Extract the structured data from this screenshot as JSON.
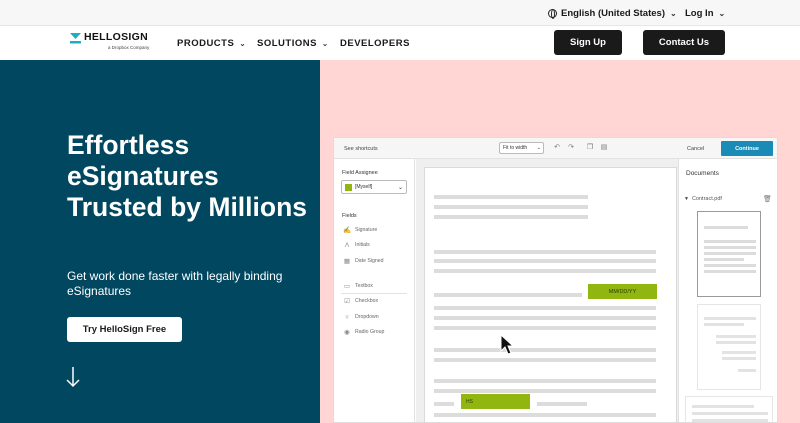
{
  "utility_bar": {
    "language_label": "English (United States)",
    "login_label": "Log In",
    "chevron": "⌄"
  },
  "nav": {
    "logo_text": "HELLOSIGN",
    "logo_subtext": "a Dropbox Company",
    "links": [
      "PRODUCTS",
      "SOLUTIONS",
      "DEVELOPERS"
    ],
    "signup_label": "Sign Up",
    "contact_label": "Contact Us"
  },
  "hero": {
    "title": "Effortless eSignatures Trusted by Millions",
    "subtitle": "Get work done faster with legally binding eSignatures",
    "cta_label": "Try HelloSign Free"
  },
  "app": {
    "shortcuts_label": "See shortcuts",
    "zoom_value": "Fit to width",
    "cancel_label": "Cancel",
    "continue_label": "Continue",
    "field_assignee_label": "Field Assignee",
    "assignee_value": "[Myself]",
    "fields_label": "Fields",
    "fields": [
      {
        "label": "Signature",
        "icon": "signature-icon"
      },
      {
        "label": "Initials",
        "icon": "initials-icon"
      },
      {
        "label": "Date Signed",
        "icon": "calendar-icon"
      },
      {
        "label": "Textbox",
        "icon": "textbox-icon"
      },
      {
        "label": "Checkbox",
        "icon": "checkbox-icon"
      },
      {
        "label": "Dropdown",
        "icon": "dropdown-icon"
      },
      {
        "label": "Radio Group",
        "icon": "radio-icon"
      }
    ],
    "date_placeholder": "MM/DD/YY",
    "initials_placeholder": "HS",
    "documents_label": "Documents",
    "file_name": "Contract.pdf"
  },
  "colors": {
    "hero_left": "#00475f",
    "hero_right": "#ffd6d4",
    "accent_green": "#91b610",
    "continue_blue": "#1a8ab6",
    "logo_teal": "#1ab0c4"
  }
}
